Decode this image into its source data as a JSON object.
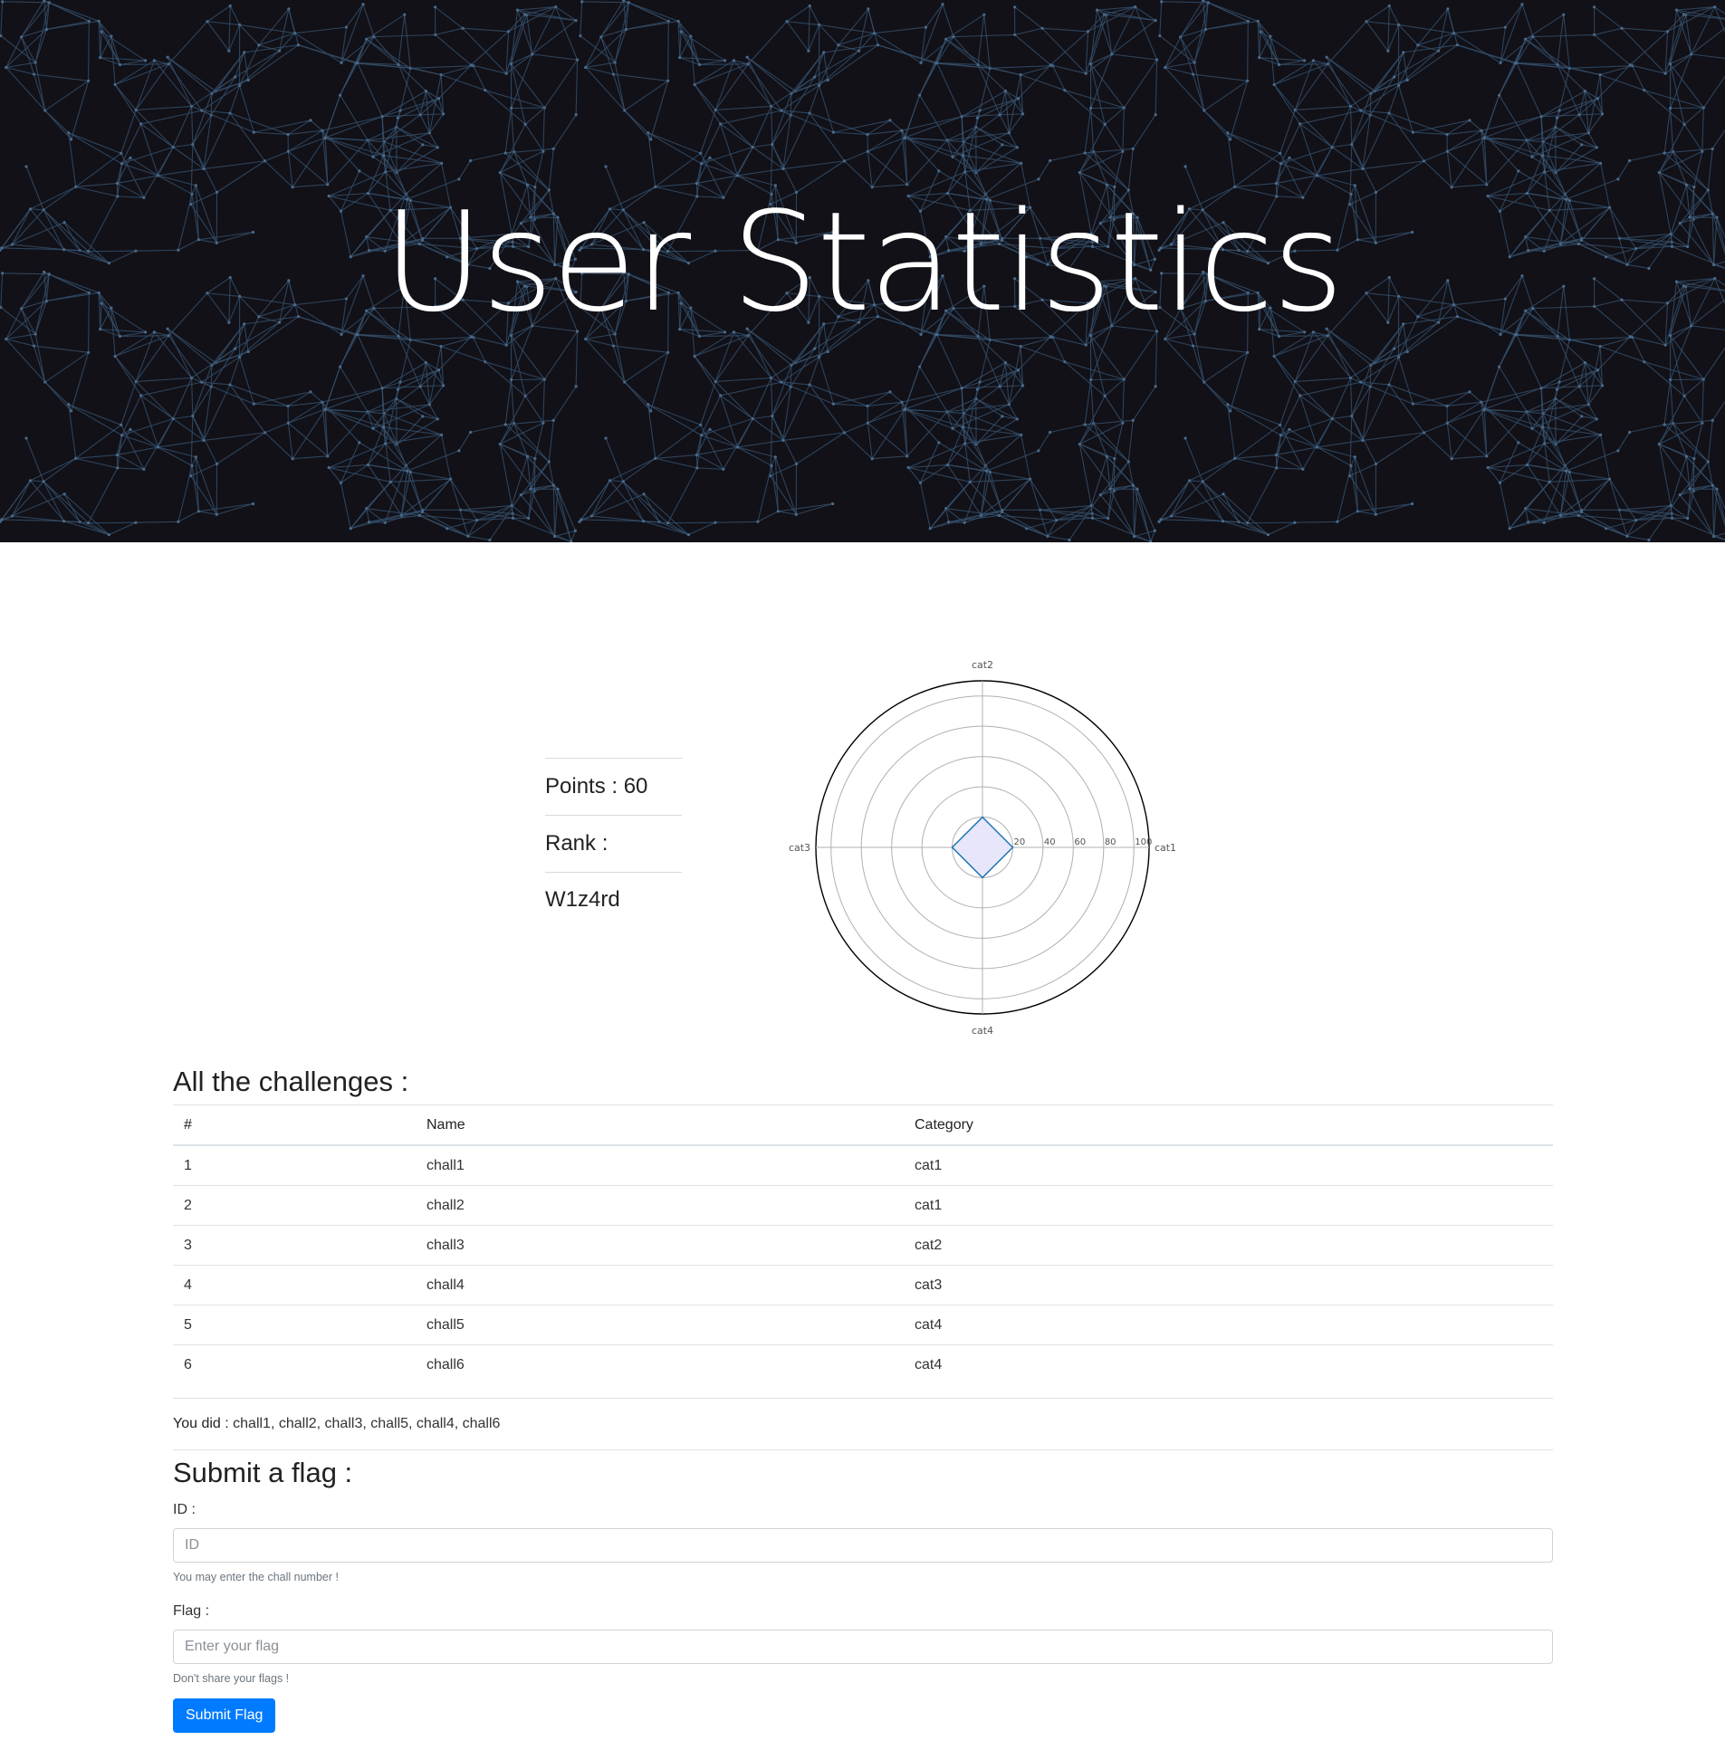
{
  "hero": {
    "title": "User Statistics"
  },
  "stats": {
    "points_label": "Points : 60",
    "rank_label": "Rank : W1z4rd"
  },
  "chart_data": {
    "type": "radar",
    "axes": [
      "cat1",
      "cat2",
      "cat3",
      "cat4"
    ],
    "series": [
      {
        "values": [
          20,
          20,
          20,
          20
        ]
      }
    ],
    "rlim": [
      0,
      110
    ],
    "rticks": [
      20,
      40,
      60,
      80,
      100
    ],
    "grid": true,
    "color": "#1f77b4",
    "fill": "#e8e6fa"
  },
  "challenges": {
    "title": "All the challenges :",
    "headers": [
      "#",
      "Name",
      "Category"
    ],
    "rows": [
      [
        "1",
        "chall1",
        "cat1"
      ],
      [
        "2",
        "chall2",
        "cat1"
      ],
      [
        "3",
        "chall3",
        "cat2"
      ],
      [
        "4",
        "chall4",
        "cat3"
      ],
      [
        "5",
        "chall5",
        "cat4"
      ],
      [
        "6",
        "chall6",
        "cat4"
      ]
    ]
  },
  "done": {
    "label": "You did :",
    "value": "chall1, chall2, chall3, chall5, chall4, chall6"
  },
  "form": {
    "title": "Submit a flag :",
    "id_label": "ID :",
    "id_placeholder": "ID",
    "id_help": "You may enter the chall number !",
    "flag_label": "Flag :",
    "flag_placeholder": "Enter your flag",
    "flag_help": "Don't share your flags !",
    "submit_label": "Submit Flag"
  },
  "colors": {
    "hero_bg": "#121118",
    "accent": "#007bff"
  }
}
